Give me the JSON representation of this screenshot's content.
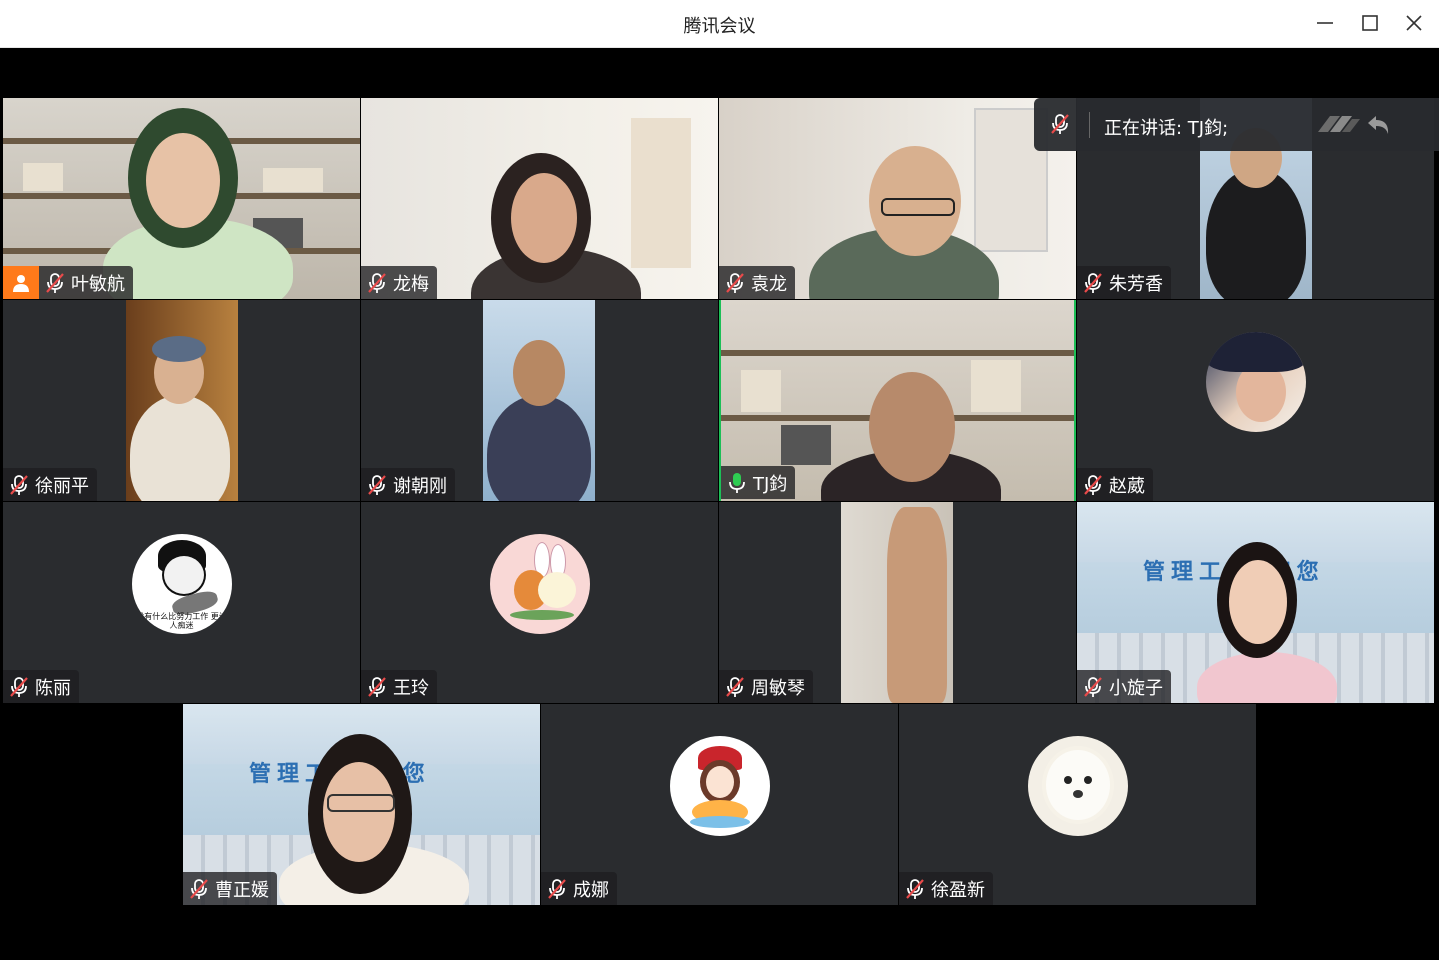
{
  "window": {
    "title": "腾讯会议"
  },
  "speaking": {
    "label": "正在讲话: TJ鈞;"
  },
  "participants": [
    {
      "name": "叶敏航",
      "host": true
    },
    {
      "name": "龙梅"
    },
    {
      "name": "袁龙"
    },
    {
      "name": "朱芳香"
    },
    {
      "name": "徐丽平"
    },
    {
      "name": "谢朝刚"
    },
    {
      "name": "TJ鈞",
      "speaking": true
    },
    {
      "name": "赵葳"
    },
    {
      "name": "陈丽"
    },
    {
      "name": "王玲"
    },
    {
      "name": "周敏琴"
    },
    {
      "name": "小旋子"
    },
    {
      "name": "曹正媛"
    },
    {
      "name": "成娜"
    },
    {
      "name": "徐盈新"
    }
  ],
  "banners": {
    "xiaoxuanzi": "管理工 欢迎您",
    "caozhengyuan": "管理工 欢迎您"
  },
  "avatars": {
    "chenli_caption": "没有什么比努力工作 更让人痴迷"
  },
  "colors": {
    "tile_bg": "#2a2c2f",
    "speaking_border": "#1dbf57",
    "host_badge": "#ff7a1a",
    "mic_muted": "#e84a4a"
  }
}
